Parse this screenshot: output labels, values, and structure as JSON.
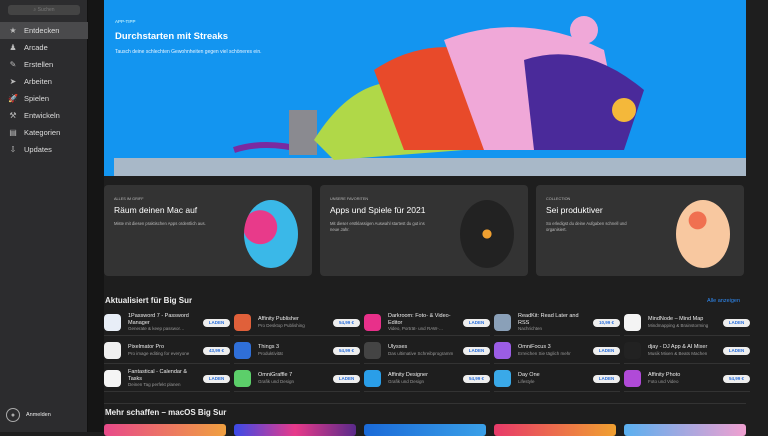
{
  "sidebar": {
    "search_placeholder": "Suchen",
    "items": [
      {
        "label": "Entdecken",
        "icon": "star-icon",
        "active": true
      },
      {
        "label": "Arcade",
        "icon": "joystick-icon"
      },
      {
        "label": "Erstellen",
        "icon": "brush-icon"
      },
      {
        "label": "Arbeiten",
        "icon": "paperplane-icon"
      },
      {
        "label": "Spielen",
        "icon": "rocket-icon"
      },
      {
        "label": "Entwickeln",
        "icon": "hammer-icon"
      },
      {
        "label": "Kategorien",
        "icon": "box-icon"
      },
      {
        "label": "Updates",
        "icon": "download-icon"
      }
    ],
    "login": "Anmelden"
  },
  "hero": {
    "eyebrow": "APP-TIPP",
    "title": "Durchstarten mit Streaks",
    "desc": "Tausch deine schlechten Gewohnheiten gegen viel schöneres ein."
  },
  "cards": [
    {
      "eyebrow": "ALLES IM GRIFF",
      "title": "Räum deinen Mac auf",
      "desc": "Miste mit diesen praktischen Apps ordentlich aus."
    },
    {
      "eyebrow": "UNSERE FAVORITEN",
      "title": "Apps und Spiele für 2021",
      "desc": "Mit dieser erstklassigen Auswahl startest du gut ins neue Jahr."
    },
    {
      "eyebrow": "COLLECTION",
      "title": "Sei produktiver",
      "desc": "So erledigst du deine Aufgaben schnell und organisiert."
    }
  ],
  "updated": {
    "title": "Aktualisiert für Big Sur",
    "see_all": "Alle anzeigen",
    "apps": [
      {
        "name": "1Password 7 - Password Manager",
        "sub": "Generate & keep passwor…",
        "btn": "LADEN",
        "color": "#e8eef7"
      },
      {
        "name": "Affinity Publisher",
        "sub": "Pro Desktop Publishing",
        "btn": "54,99 €",
        "color": "#e0603a"
      },
      {
        "name": "Darkroom: Foto- & Video-Editor",
        "sub": "Video, Porträt- und RAW-…",
        "btn": "LADEN",
        "color": "#e8308a"
      },
      {
        "name": "ReadKit: Read Later and RSS",
        "sub": "Nachrichten",
        "btn": "10,99 €",
        "color": "#8aa0b8"
      },
      {
        "name": "MindNode – Mind Map",
        "sub": "Mindmapping & Brainstorming",
        "btn": "LADEN",
        "color": "#f4f4f4"
      },
      {
        "name": "Pixelmator Pro",
        "sub": "Pro image editing for everyone",
        "btn": "43,99 €",
        "color": "#f0f0f0"
      },
      {
        "name": "Things 3",
        "sub": "Produktivität",
        "btn": "54,99 €",
        "color": "#2f6fd8"
      },
      {
        "name": "Ulysses",
        "sub": "Das ultimative Schreibprogramm",
        "btn": "LADEN",
        "color": "#444"
      },
      {
        "name": "OmniFocus 3",
        "sub": "Erreichen Sie täglich mehr",
        "btn": "LADEN",
        "color": "#9b5de5"
      },
      {
        "name": "djay - DJ App & AI Mixer",
        "sub": "Musik Mixen & Beats Machen",
        "btn": "LADEN",
        "color": "#222"
      },
      {
        "name": "Fantastical - Calendar & Tasks",
        "sub": "Deinen Tag perfekt planen",
        "btn": "LADEN",
        "color": "#f5f5f5"
      },
      {
        "name": "OmniGraffle 7",
        "sub": "Grafik und Design",
        "btn": "LADEN",
        "color": "#5ccf6a"
      },
      {
        "name": "Affinity Designer",
        "sub": "Grafik und Design",
        "btn": "54,99 €",
        "color": "#2a9ee8"
      },
      {
        "name": "Day One",
        "sub": "Lifestyle",
        "btn": "LADEN",
        "color": "#3aa9e8"
      },
      {
        "name": "Affinity Photo",
        "sub": "Foto und Video",
        "btn": "54,99 €",
        "color": "#b04ad8"
      }
    ]
  },
  "more": {
    "title": "Mehr schaffen – macOS Big Sur"
  }
}
